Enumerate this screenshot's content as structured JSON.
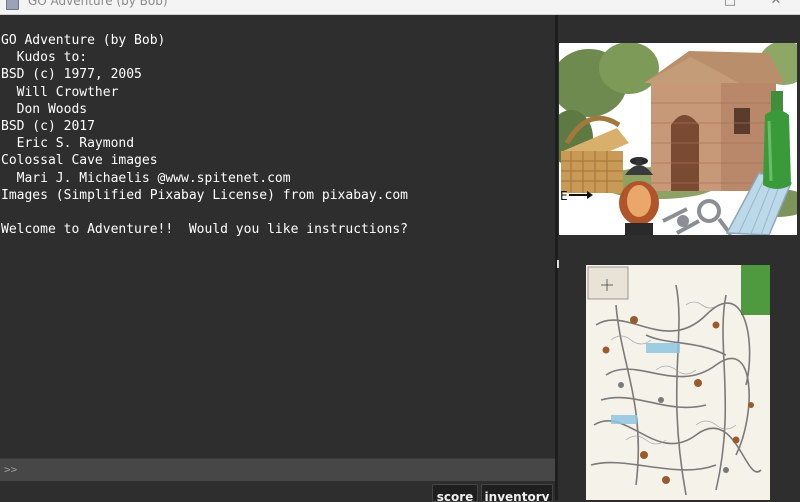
{
  "window": {
    "title": "GO Adventure (by Bob)",
    "max_icon": "maximize-icon",
    "close_icon": "close-icon"
  },
  "output": {
    "lines": [
      "GO Adventure (by Bob)",
      "  Kudos to:",
      "BSD (c) 1977, 2005",
      "  Will Crowther",
      "  Don Woods",
      "BSD (c) 2017",
      "  Eric S. Raymond",
      "Colossal Cave images",
      "  Mari J. Michaelis @www.spitenet.com",
      "Images (Simplified Pixabay License) from pixabay.com",
      "",
      "Welcome to Adventure!!  Would you like instructions?"
    ]
  },
  "input": {
    "prompt": ">>",
    "value": ""
  },
  "buttons": {
    "score": "score",
    "inventory": "inventory"
  },
  "scene": {
    "arrow_label": "E",
    "icons": [
      "brick-hut-icon",
      "picnic-basket-icon",
      "lantern-icon",
      "keys-icon",
      "green-bottle-icon",
      "bird-cage-icon"
    ]
  },
  "map": {
    "icon": "cave-map-icon"
  }
}
